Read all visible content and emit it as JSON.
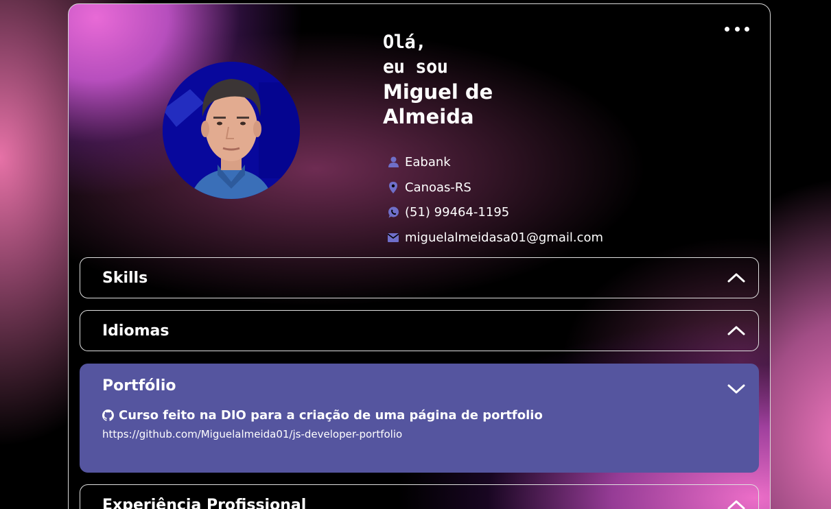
{
  "profile": {
    "greeting": "Olá,",
    "iam": "eu sou",
    "name_line1": "Miguel de",
    "name_line2": "Almeida",
    "job": "Eabank",
    "location": "Canoas-RS",
    "phone": "(51) 99464-1195",
    "email": "miguelalmeidasa01@gmail.com"
  },
  "sections": {
    "skills": "Skills",
    "languages": "Idiomas",
    "portfolio": "Portfólio",
    "experience": "Experiência Profissional"
  },
  "portfolio": {
    "project_title": "Curso feito na DIO para a criação de uma página de portfolio",
    "project_url": "https://github.com/Miguelalmeida01/js-developer-portfolio"
  },
  "colors": {
    "accent": "#55559f",
    "icon": "#6f6fc9"
  }
}
